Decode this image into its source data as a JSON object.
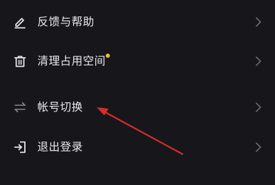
{
  "menu": {
    "items": [
      {
        "label": "反馈与帮助",
        "icon": "edit-icon"
      },
      {
        "label": "清理占用空间",
        "icon": "trash-icon",
        "badge": "new-dot"
      },
      {
        "label": "帐号切换",
        "icon": "switch-arrows-icon"
      },
      {
        "label": "退出登录",
        "icon": "logout-icon"
      }
    ]
  },
  "colors": {
    "background": "#17171b",
    "text": "#e9e9ec",
    "icon": "#e9e9ec",
    "icon_dim": "#8a8a90",
    "chevron": "#6b6b70",
    "badge": "#f2c12e",
    "annotation_arrow": "#d92b2b"
  }
}
